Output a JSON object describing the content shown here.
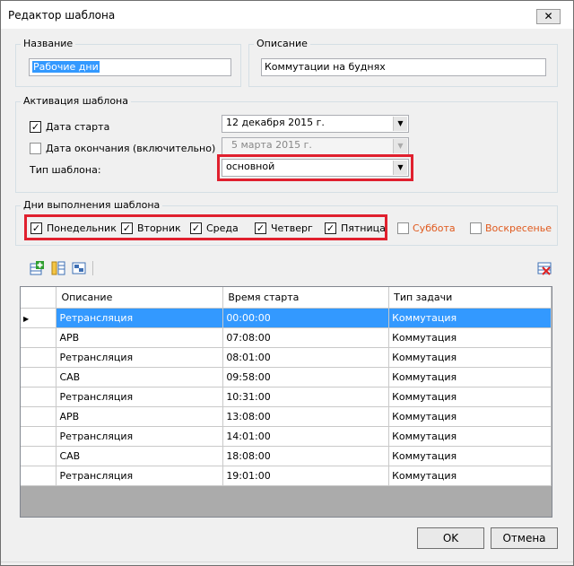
{
  "window": {
    "title": "Редактор шаблона",
    "close_label": "✕"
  },
  "name_group": {
    "legend": "Название",
    "value": "Рабочие дни"
  },
  "desc_group": {
    "legend": "Описание",
    "value": "Коммутации на буднях"
  },
  "activation": {
    "legend": "Активация шаблона",
    "start": {
      "label": "Дата старта",
      "checked": true,
      "value": "12 декабря  2015 г."
    },
    "end": {
      "label": "Дата окончания (включительно)",
      "checked": false,
      "value": "5    марта   2015 г."
    },
    "type": {
      "label": "Тип шаблона:",
      "value": "основной"
    }
  },
  "days": {
    "legend": "Дни выполнения шаблона",
    "items": [
      {
        "label": "Понедельник",
        "checked": true
      },
      {
        "label": "Вторник",
        "checked": true
      },
      {
        "label": "Среда",
        "checked": true
      },
      {
        "label": "Четверг",
        "checked": true
      },
      {
        "label": "Пятница",
        "checked": true
      },
      {
        "label": "Суббота",
        "checked": false
      },
      {
        "label": "Воскресенье",
        "checked": false
      }
    ]
  },
  "toolbar": {
    "icons": [
      "add-row-icon",
      "copy-row-icon",
      "edit-row-icon",
      "delete-row-icon"
    ]
  },
  "grid": {
    "columns": [
      "Описание",
      "Время старта",
      "Тип задачи"
    ],
    "rows": [
      [
        "Ретрансляция",
        "00:00:00",
        "Коммутация"
      ],
      [
        "АРВ",
        "07:08:00",
        "Коммутация"
      ],
      [
        "Ретрансляция",
        "08:01:00",
        "Коммутация"
      ],
      [
        "САВ",
        "09:58:00",
        "Коммутация"
      ],
      [
        "Ретрансляция",
        "10:31:00",
        "Коммутация"
      ],
      [
        "АРВ",
        "13:08:00",
        "Коммутация"
      ],
      [
        "Ретрансляция",
        "14:01:00",
        "Коммутация"
      ],
      [
        "САВ",
        "18:08:00",
        "Коммутация"
      ],
      [
        "Ретрансляция",
        "19:01:00",
        "Коммутация"
      ]
    ],
    "selected_row": 0,
    "row_marker": "▶"
  },
  "buttons": {
    "ok": "OK",
    "cancel": "Отмена"
  },
  "colors": {
    "selection": "#3399ff",
    "highlight_border": "#e0202e",
    "weekend_text": "#e05a1e"
  }
}
